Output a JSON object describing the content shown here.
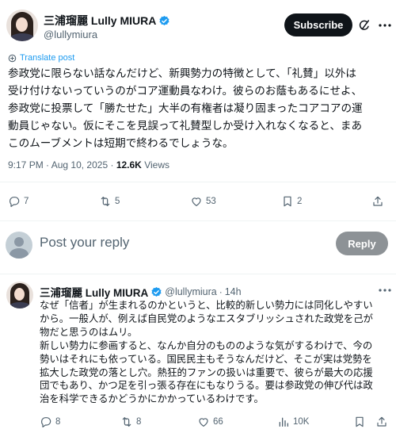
{
  "post": {
    "author": {
      "display_name": "三浦瑠麗 Lully MIURA",
      "handle": "@lullymiura"
    },
    "subscribe_label": "Subscribe",
    "translate_label": "Translate post",
    "text_lines": [
      "参政党に限らない話なんだけど、新興勢力の特徴として、「礼賛」以外は",
      "受け付けないっていうのがコア運動員なわけ。彼らのお蔭もあるにせよ、",
      "参政党に投票して「勝たせた」大半の有権者は凝り固まったコアコアの運",
      "動員じゃない。仮にそこを見誤って礼賛型しか受け入れなくなると、まあ",
      "このムーブメントは短期で終わるでしょうな。"
    ],
    "time": "9:17 PM",
    "date": "Aug 10, 2025",
    "views_count": "12.6K",
    "views_label": "Views",
    "stats": {
      "replies": "7",
      "reposts": "5",
      "likes": "53",
      "bookmarks": "2"
    }
  },
  "compose": {
    "placeholder": "Post your reply",
    "reply_label": "Reply"
  },
  "reply": {
    "author": {
      "display_name": "三浦瑠麗 Lully MIURA",
      "handle": "@lullymiura"
    },
    "time_ago": "14h",
    "text_lines": [
      "なぜ「信者」が生まれるのかというと、比較的新しい勢力には同化しやすい",
      "から。一般人が、例えば自民党のようなエスタブリッシュされた政党を己が",
      "物だと思うのはムリ。",
      "新しい勢力に参画すると、なんか自分のもののような気がするわけで、今の",
      "勢いはそれにも依っている。国民民主もそうなんだけど、そこが実は党勢を",
      "拡大した政党の落とし穴。熱狂的ファンの扱いは重要で、彼らが最大の応援",
      "団でもあり、かつ足を引っ張る存在にもなりうる。要は参政党の伸び代は政",
      "治を科学できるかどうかにかかっているわけです。"
    ],
    "stats": {
      "replies": "8",
      "reposts": "8",
      "likes": "66",
      "views": "10K"
    }
  },
  "icons": {
    "verified": "verified-badge-icon",
    "grok": "grok-icon",
    "more": "more-icon",
    "translate": "translate-icon",
    "reply": "reply-icon",
    "repost": "repost-icon",
    "like": "like-icon",
    "bookmark": "bookmark-icon",
    "share": "share-icon",
    "views": "views-icon"
  },
  "colors": {
    "accent": "#1d9bf0",
    "text": "#0f1419",
    "muted": "#536471",
    "divider": "#eff3f4",
    "subscribe_bg": "#0f1419",
    "reply_button_bg": "#8d9296"
  }
}
